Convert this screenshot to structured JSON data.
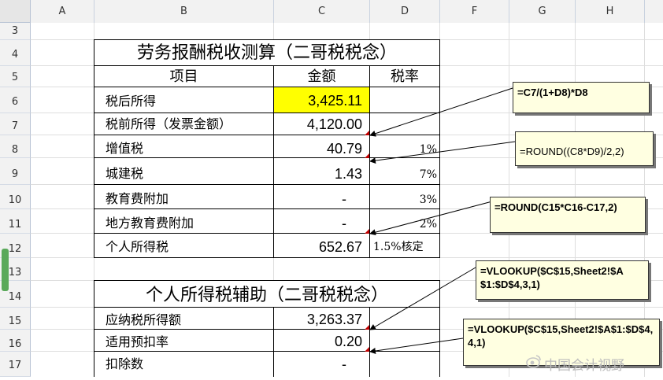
{
  "columns": [
    "A",
    "B",
    "C",
    "D",
    "F",
    "G",
    "H"
  ],
  "rows": [
    "3",
    "4",
    "5",
    "6",
    "7",
    "8",
    "9",
    "10",
    "11",
    "12",
    "13",
    "14",
    "15",
    "16",
    "17"
  ],
  "table1": {
    "title": "劳务报酬税收测算（二哥税税念）",
    "headers": [
      "项目",
      "金额",
      "税率"
    ],
    "rows": [
      {
        "label": "税后所得",
        "amount": "3,425.11",
        "rate": ""
      },
      {
        "label": "税前所得（发票金额）",
        "amount": "4,120.00",
        "rate": ""
      },
      {
        "label": "增值税",
        "amount": "40.79",
        "rate": "1%"
      },
      {
        "label": "城建税",
        "amount": "1.43",
        "rate": "7%"
      },
      {
        "label": "教育费附加",
        "amount": "-",
        "rate": "3%"
      },
      {
        "label": "地方教育费附加",
        "amount": "-",
        "rate": "2%"
      },
      {
        "label": "个人所得税",
        "amount": "652.67",
        "rate": "1.5%核定"
      }
    ]
  },
  "table2": {
    "title": "个人所得税辅助（二哥税税念）",
    "rows": [
      {
        "label": "应纳税所得额",
        "amount": "3,263.37",
        "rate": ""
      },
      {
        "label": "适用预扣率",
        "amount": "0.20",
        "rate": ""
      },
      {
        "label": "扣除数",
        "amount": "-",
        "rate": ""
      }
    ]
  },
  "notes": [
    "=C7/(1+D8)*D8",
    "=ROUND((C8*D9)/2,2)",
    "=ROUND(C15*C16-C17,2)",
    "=VLOOKUP($C$15,Sheet2!$A$1:$D$4,3,1)",
    "=VLOOKUP($C$15,Sheet2!$A$1:$D$4,4,1)"
  ],
  "watermark": "中国会计视野",
  "colors": {
    "highlight": "#ffff00",
    "note_bg": "#ffffe1",
    "header_bg": "#f2f2f2"
  }
}
